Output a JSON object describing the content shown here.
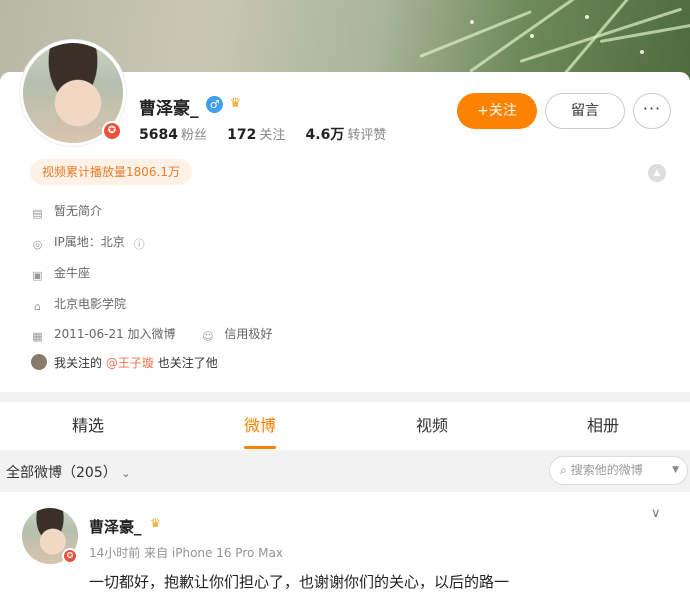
{
  "profile": {
    "name": "曹泽豪_",
    "gender_icon": "male-symbol-icon",
    "verified_icon": "verified-badge-icon",
    "stats": [
      {
        "value": "5684",
        "label": "粉丝"
      },
      {
        "value": "172",
        "label": "关注"
      },
      {
        "value": "4.6万",
        "label": "转评赞"
      }
    ],
    "follow_label": "+关注",
    "message_label": "留言",
    "more_label": "···",
    "video_views": "视频累计播放量1806.1万",
    "info": [
      {
        "icon": "document-icon",
        "text": "暂无简介"
      },
      {
        "icon": "ip-icon",
        "text": "IP属地：北京"
      },
      {
        "icon": "zodiac-icon",
        "text": "金牛座"
      },
      {
        "icon": "school-icon",
        "text": "北京电影学院"
      }
    ],
    "join_date": "2011-06-21 加入微博",
    "credit": "信用极好",
    "mutual": {
      "prefix": "我关注的",
      "user": "@王子璇",
      "suffix": "也关注了他"
    }
  },
  "tabs": [
    {
      "label": "精选",
      "active": false
    },
    {
      "label": "微博",
      "active": true
    },
    {
      "label": "视频",
      "active": false
    },
    {
      "label": "相册",
      "active": false
    }
  ],
  "filter": {
    "label": "全部微博（205）",
    "search_placeholder": "搜索他的微博"
  },
  "post": {
    "author": "曹泽豪_",
    "meta": "14小时前  来自 iPhone 16 Pro Max",
    "text": "一切都好，抱歉让你们担心了，也谢谢你们的关心，以后的路一"
  },
  "colors": {
    "accent": "#ff8200",
    "link": "#eb7350",
    "badge": "#e8523a"
  }
}
